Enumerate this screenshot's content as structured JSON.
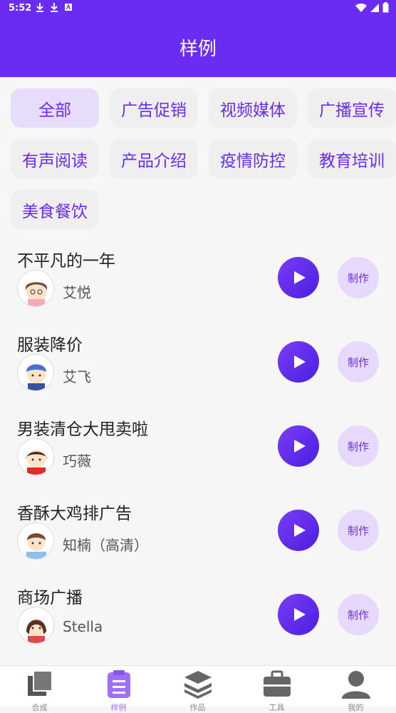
{
  "status_bar": {
    "time": "5:52"
  },
  "header": {
    "title": "样例"
  },
  "categories": [
    {
      "label": "全部",
      "active": true
    },
    {
      "label": "广告促销"
    },
    {
      "label": "视频媒体"
    },
    {
      "label": "广播宣传"
    },
    {
      "label": "有声阅读"
    },
    {
      "label": "产品介绍"
    },
    {
      "label": "疫情防控"
    },
    {
      "label": "教育培训"
    },
    {
      "label": "美食餐饮"
    }
  ],
  "samples": [
    {
      "title": "不平凡的一年",
      "speaker": "艾悦",
      "make_label": "制作"
    },
    {
      "title": "服装降价",
      "speaker": "艾飞",
      "make_label": "制作"
    },
    {
      "title": "男装清仓大甩卖啦",
      "speaker": "巧薇",
      "make_label": "制作"
    },
    {
      "title": "香酥大鸡排广告",
      "speaker": "知楠（高清）",
      "make_label": "制作"
    },
    {
      "title": "商场广播",
      "speaker": "Stella",
      "make_label": "制作"
    }
  ],
  "nav": [
    {
      "label": "合成",
      "icon": "copy-icon"
    },
    {
      "label": "样例",
      "icon": "clipboard-icon",
      "active": true
    },
    {
      "label": "作品",
      "icon": "layers-icon"
    },
    {
      "label": "工具",
      "icon": "toolbox-icon"
    },
    {
      "label": "我的",
      "icon": "person-icon"
    }
  ],
  "colors": {
    "accent": "#6a2bf3",
    "chip_active_bg": "#e8dcfb",
    "make_bg": "#e6d9fb"
  }
}
